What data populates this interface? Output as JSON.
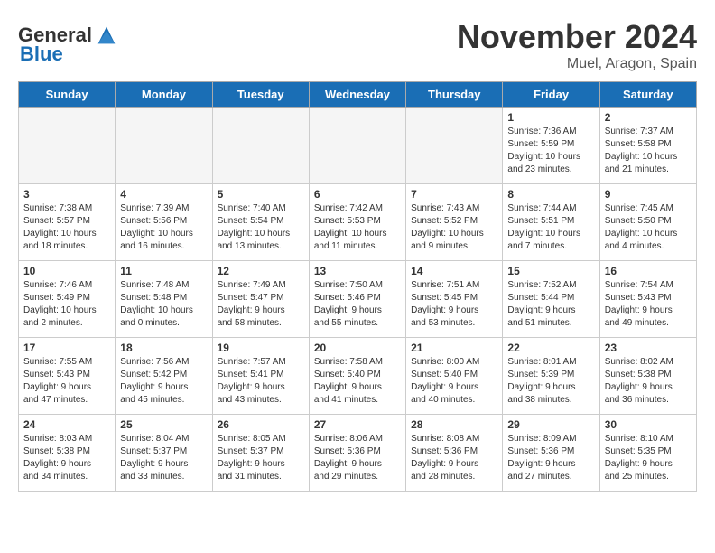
{
  "header": {
    "logo_general": "General",
    "logo_blue": "Blue",
    "month_title": "November 2024",
    "location": "Muel, Aragon, Spain"
  },
  "days_of_week": [
    "Sunday",
    "Monday",
    "Tuesday",
    "Wednesday",
    "Thursday",
    "Friday",
    "Saturday"
  ],
  "weeks": [
    [
      {
        "day": "",
        "info": ""
      },
      {
        "day": "",
        "info": ""
      },
      {
        "day": "",
        "info": ""
      },
      {
        "day": "",
        "info": ""
      },
      {
        "day": "",
        "info": ""
      },
      {
        "day": "1",
        "info": "Sunrise: 7:36 AM\nSunset: 5:59 PM\nDaylight: 10 hours\nand 23 minutes."
      },
      {
        "day": "2",
        "info": "Sunrise: 7:37 AM\nSunset: 5:58 PM\nDaylight: 10 hours\nand 21 minutes."
      }
    ],
    [
      {
        "day": "3",
        "info": "Sunrise: 7:38 AM\nSunset: 5:57 PM\nDaylight: 10 hours\nand 18 minutes."
      },
      {
        "day": "4",
        "info": "Sunrise: 7:39 AM\nSunset: 5:56 PM\nDaylight: 10 hours\nand 16 minutes."
      },
      {
        "day": "5",
        "info": "Sunrise: 7:40 AM\nSunset: 5:54 PM\nDaylight: 10 hours\nand 13 minutes."
      },
      {
        "day": "6",
        "info": "Sunrise: 7:42 AM\nSunset: 5:53 PM\nDaylight: 10 hours\nand 11 minutes."
      },
      {
        "day": "7",
        "info": "Sunrise: 7:43 AM\nSunset: 5:52 PM\nDaylight: 10 hours\nand 9 minutes."
      },
      {
        "day": "8",
        "info": "Sunrise: 7:44 AM\nSunset: 5:51 PM\nDaylight: 10 hours\nand 7 minutes."
      },
      {
        "day": "9",
        "info": "Sunrise: 7:45 AM\nSunset: 5:50 PM\nDaylight: 10 hours\nand 4 minutes."
      }
    ],
    [
      {
        "day": "10",
        "info": "Sunrise: 7:46 AM\nSunset: 5:49 PM\nDaylight: 10 hours\nand 2 minutes."
      },
      {
        "day": "11",
        "info": "Sunrise: 7:48 AM\nSunset: 5:48 PM\nDaylight: 10 hours\nand 0 minutes."
      },
      {
        "day": "12",
        "info": "Sunrise: 7:49 AM\nSunset: 5:47 PM\nDaylight: 9 hours\nand 58 minutes."
      },
      {
        "day": "13",
        "info": "Sunrise: 7:50 AM\nSunset: 5:46 PM\nDaylight: 9 hours\nand 55 minutes."
      },
      {
        "day": "14",
        "info": "Sunrise: 7:51 AM\nSunset: 5:45 PM\nDaylight: 9 hours\nand 53 minutes."
      },
      {
        "day": "15",
        "info": "Sunrise: 7:52 AM\nSunset: 5:44 PM\nDaylight: 9 hours\nand 51 minutes."
      },
      {
        "day": "16",
        "info": "Sunrise: 7:54 AM\nSunset: 5:43 PM\nDaylight: 9 hours\nand 49 minutes."
      }
    ],
    [
      {
        "day": "17",
        "info": "Sunrise: 7:55 AM\nSunset: 5:43 PM\nDaylight: 9 hours\nand 47 minutes."
      },
      {
        "day": "18",
        "info": "Sunrise: 7:56 AM\nSunset: 5:42 PM\nDaylight: 9 hours\nand 45 minutes."
      },
      {
        "day": "19",
        "info": "Sunrise: 7:57 AM\nSunset: 5:41 PM\nDaylight: 9 hours\nand 43 minutes."
      },
      {
        "day": "20",
        "info": "Sunrise: 7:58 AM\nSunset: 5:40 PM\nDaylight: 9 hours\nand 41 minutes."
      },
      {
        "day": "21",
        "info": "Sunrise: 8:00 AM\nSunset: 5:40 PM\nDaylight: 9 hours\nand 40 minutes."
      },
      {
        "day": "22",
        "info": "Sunrise: 8:01 AM\nSunset: 5:39 PM\nDaylight: 9 hours\nand 38 minutes."
      },
      {
        "day": "23",
        "info": "Sunrise: 8:02 AM\nSunset: 5:38 PM\nDaylight: 9 hours\nand 36 minutes."
      }
    ],
    [
      {
        "day": "24",
        "info": "Sunrise: 8:03 AM\nSunset: 5:38 PM\nDaylight: 9 hours\nand 34 minutes."
      },
      {
        "day": "25",
        "info": "Sunrise: 8:04 AM\nSunset: 5:37 PM\nDaylight: 9 hours\nand 33 minutes."
      },
      {
        "day": "26",
        "info": "Sunrise: 8:05 AM\nSunset: 5:37 PM\nDaylight: 9 hours\nand 31 minutes."
      },
      {
        "day": "27",
        "info": "Sunrise: 8:06 AM\nSunset: 5:36 PM\nDaylight: 9 hours\nand 29 minutes."
      },
      {
        "day": "28",
        "info": "Sunrise: 8:08 AM\nSunset: 5:36 PM\nDaylight: 9 hours\nand 28 minutes."
      },
      {
        "day": "29",
        "info": "Sunrise: 8:09 AM\nSunset: 5:36 PM\nDaylight: 9 hours\nand 27 minutes."
      },
      {
        "day": "30",
        "info": "Sunrise: 8:10 AM\nSunset: 5:35 PM\nDaylight: 9 hours\nand 25 minutes."
      }
    ]
  ]
}
